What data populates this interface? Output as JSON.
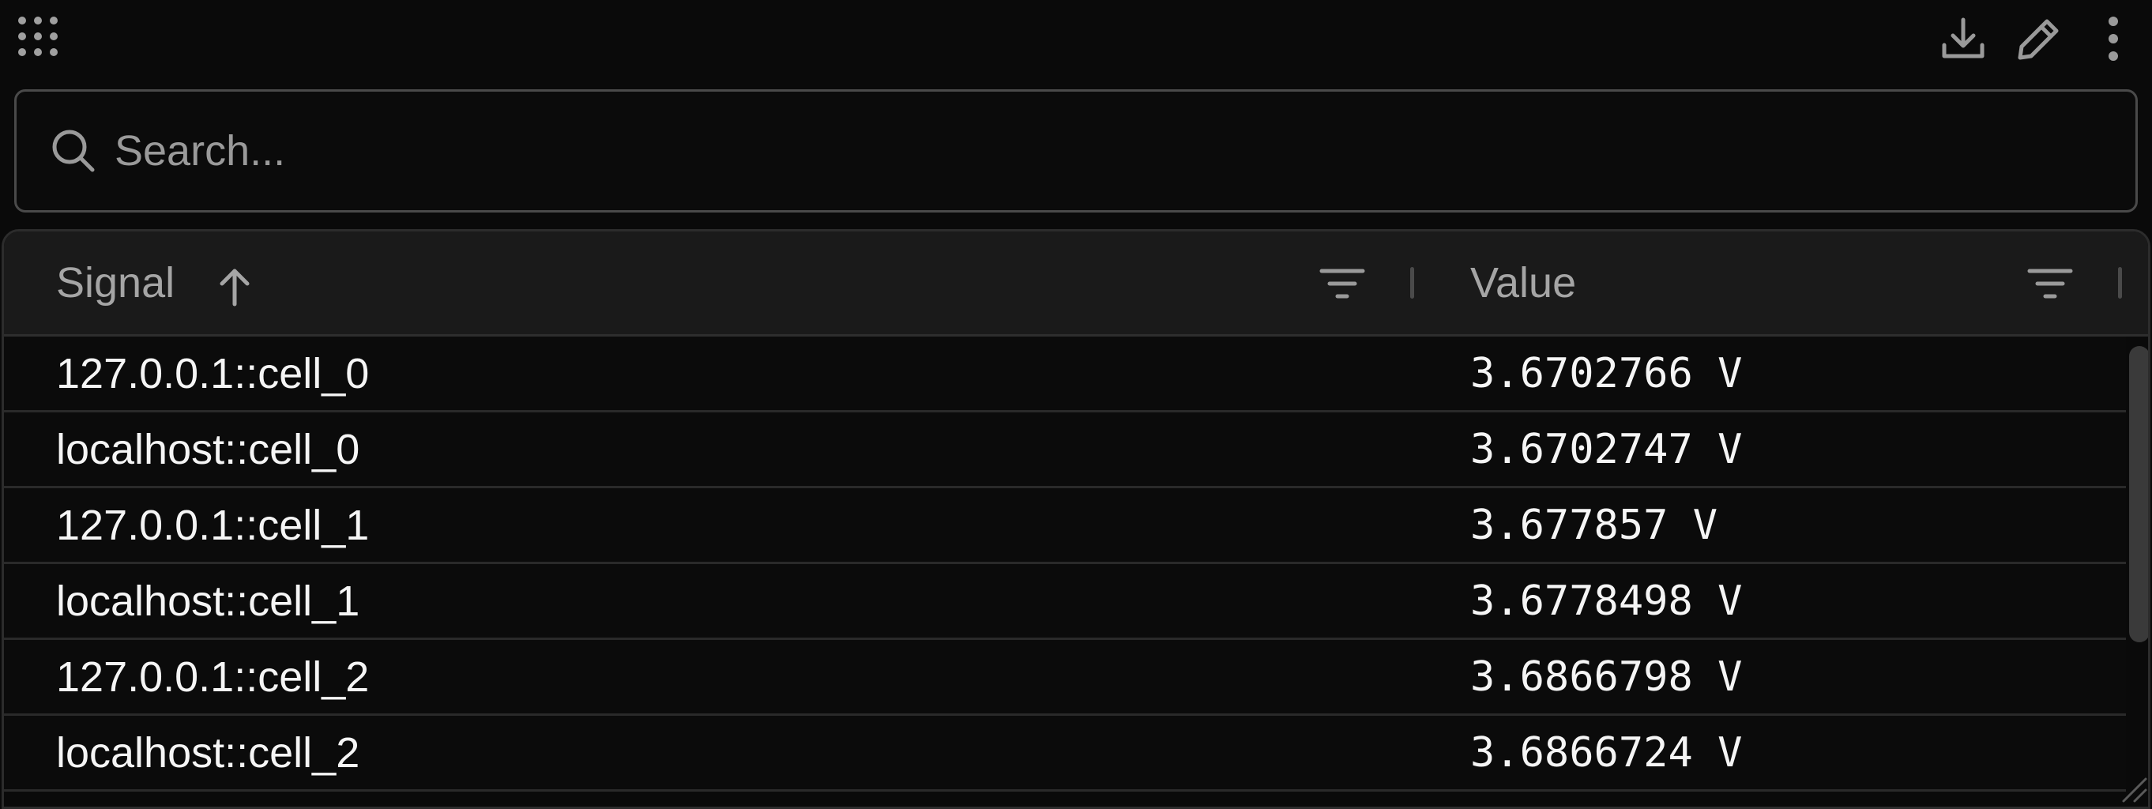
{
  "toolbar": {
    "icons": {
      "menu": "grid-icon",
      "download": "download-icon",
      "edit": "pencil-icon",
      "more": "kebab-icon"
    }
  },
  "search": {
    "placeholder": "Search...",
    "value": ""
  },
  "table": {
    "columns": [
      {
        "label": "Signal",
        "sort": "ascending"
      },
      {
        "label": "Value"
      }
    ],
    "rows": [
      {
        "signal": "127.0.0.1::cell_0",
        "value": "3.6702766 V"
      },
      {
        "signal": "localhost::cell_0",
        "value": "3.6702747 V"
      },
      {
        "signal": "127.0.0.1::cell_1",
        "value": "3.677857 V"
      },
      {
        "signal": "localhost::cell_1",
        "value": "3.6778498 V"
      },
      {
        "signal": "127.0.0.1::cell_2",
        "value": "3.6866798 V"
      },
      {
        "signal": "localhost::cell_2",
        "value": "3.6866724 V"
      }
    ]
  },
  "colors": {
    "background": "#0a0a0a",
    "header_background": "#1a1a1a",
    "border": "#4a4a4a",
    "text": "#f5f5f5",
    "muted_text": "#a5a5a5"
  }
}
